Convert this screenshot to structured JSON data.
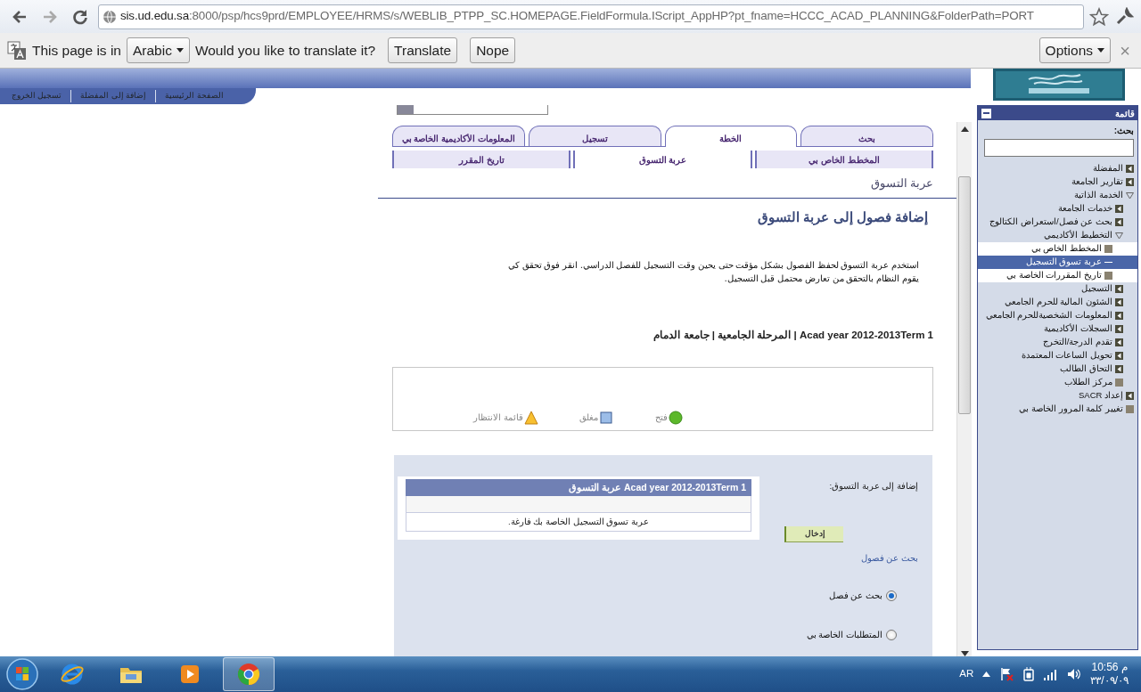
{
  "browser": {
    "url_host": "sis.ud.edu.sa",
    "url_path": ":8000/psp/hcs9prd/EMPLOYEE/HRMS/s/WEBLIB_PTPP_SC.HOMEPAGE.FieldFormula.IScript_AppHP?pt_fname=HCCC_ACAD_PLANNING&FolderPath=PORT"
  },
  "translate_bar": {
    "prefix": "This page is in",
    "language": "Arabic",
    "question": "Would you like to translate it?",
    "translate_button": "Translate",
    "dismiss_button": "Nope",
    "options": "Options",
    "close": "×"
  },
  "header": {
    "links": [
      "الصفحة الرئيسية",
      "إضافة إلى المفضلة",
      "تسجيل الخروج"
    ]
  },
  "tabs": [
    {
      "label": "بحث",
      "selected": false
    },
    {
      "label": "الخطة",
      "selected": true
    },
    {
      "label": "تسجيل",
      "selected": false
    },
    {
      "label": "المعلومات الأكاديمية الخاصة بي",
      "selected": false
    }
  ],
  "sub_tabs": [
    {
      "label": "المخطط الخاص بي",
      "selected": false
    },
    {
      "label": "عربة التسوق",
      "selected": true
    },
    {
      "label": "تاريخ المقرر",
      "selected": false
    }
  ],
  "page_title": "عربة التسوق",
  "heading": "إضافة فصول إلى عربة التسوق",
  "instructions": "استخدم عربة التسوق لحفظ الفصول بشكل مؤقت حتى يحين وقت التسجيل للفصل الدراسي.  انقر فوق تحقق كي يقوم النظام بالتحقق من تعارض محتمل قبل التسجيل.",
  "term_line": "Acad year 2012-2013Term 1 | المرحلة الجامعية | جامعة الدمام",
  "legend": [
    {
      "kind": "open",
      "label": "فتح"
    },
    {
      "kind": "closed",
      "label": "مغلق"
    },
    {
      "kind": "waitlist",
      "label": "قائمة الانتظار"
    }
  ],
  "cart": {
    "add_label": "إضافة إلى عربة التسوق:",
    "enter_button": "إدخال",
    "search_heading": "بحث عن فصول",
    "options": [
      {
        "label": "بحث عن فصل",
        "selected": true
      },
      {
        "label": "المتطلبات الخاصة بي",
        "selected": false
      }
    ],
    "table": {
      "title": "Acad year 2012-2013Term 1 عربة التسوق",
      "empty_message": "عربة تسوق التسجيل الخاصة بك فارغة."
    }
  },
  "sidebar": {
    "title": "قائمة",
    "search_label": "بحث:",
    "tree": [
      {
        "kind": "folder",
        "label": "المفضلة",
        "expanded": false
      },
      {
        "kind": "folder",
        "label": "تقارير الجامعة",
        "expanded": false
      },
      {
        "kind": "folder",
        "label": "الخدمة الذاتية",
        "expanded": true,
        "children": [
          {
            "kind": "folder",
            "label": "خدمات الجامعة",
            "expanded": false
          },
          {
            "kind": "folder",
            "label": "بحث عن فصل/استعراض الكتالوج",
            "expanded": false
          },
          {
            "kind": "folder",
            "label": "التخطيط الأكاديمي",
            "expanded": true,
            "children": [
              {
                "kind": "link",
                "label": "المخطط الخاص بي",
                "selected": false
              },
              {
                "kind": "link",
                "label": "عربة تسوق التسجيل",
                "selected": true
              },
              {
                "kind": "link",
                "label": "تاريخ المقررات الخاصة بي",
                "selected": false
              }
            ]
          },
          {
            "kind": "folder",
            "label": "التسجيل",
            "expanded": false
          },
          {
            "kind": "folder",
            "label": "الشئون المالية للحرم الجامعي",
            "expanded": false
          },
          {
            "kind": "folder",
            "label": "المعلومات الشخصيةللحرم الجامعي",
            "expanded": false
          },
          {
            "kind": "folder",
            "label": "السجلات الأكاديمية",
            "expanded": false
          },
          {
            "kind": "folder",
            "label": "تقدم الدرجة/التخرج",
            "expanded": false
          },
          {
            "kind": "folder",
            "label": "تحويل الساعات المعتمدة",
            "expanded": false
          },
          {
            "kind": "folder",
            "label": "التحاق الطالب",
            "expanded": false
          },
          {
            "kind": "link",
            "label": "مركز الطلاب",
            "selected": false
          }
        ]
      },
      {
        "kind": "folder",
        "label": "إعداد SACR",
        "expanded": false
      },
      {
        "kind": "link",
        "label": "تغيير كلمة المرور الخاصة بي",
        "selected": false
      }
    ]
  },
  "taskbar": {
    "apps": [
      {
        "kind": "ie",
        "selected": false
      },
      {
        "kind": "folder",
        "selected": false
      },
      {
        "kind": "media",
        "selected": false
      },
      {
        "kind": "chrome",
        "selected": true
      }
    ],
    "language": "AR",
    "time": "10:56 م",
    "date": "٣٣/٠٩/٠٩"
  }
}
